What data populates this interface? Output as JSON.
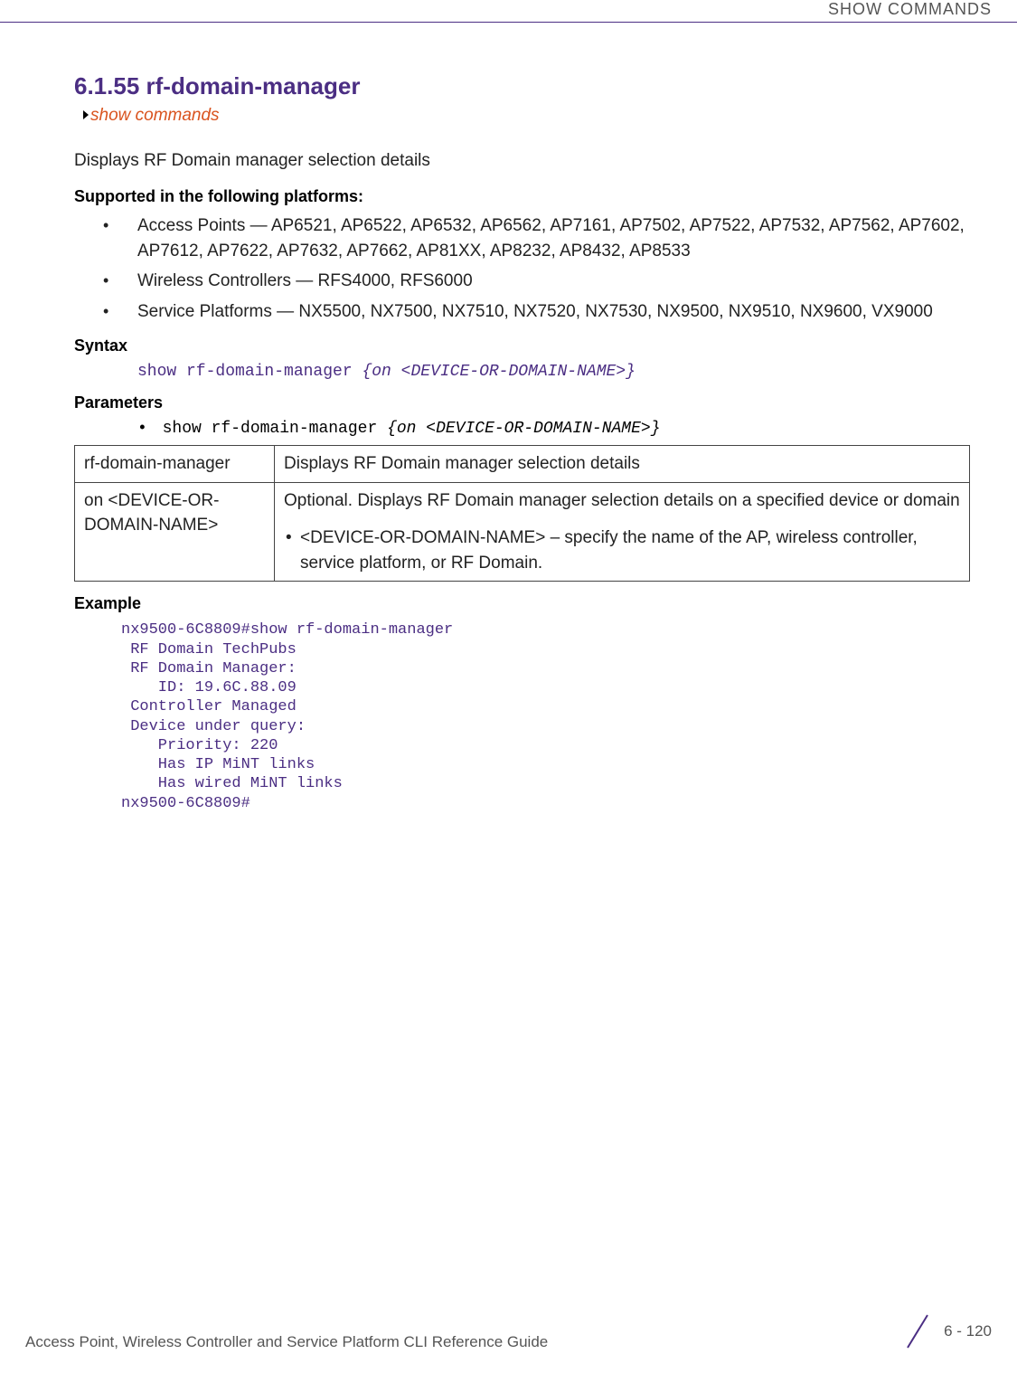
{
  "header": {
    "chapter": "SHOW COMMANDS"
  },
  "section": {
    "number_title": "6.1.55 rf-domain-manager",
    "breadcrumb": "show commands",
    "intro": "Displays RF Domain manager selection details"
  },
  "supported": {
    "heading": "Supported in the following platforms:",
    "items": [
      "Access Points — AP6521, AP6522, AP6532, AP6562, AP7161, AP7502, AP7522, AP7532, AP7562, AP7602, AP7612, AP7622, AP7632, AP7662, AP81XX, AP8232, AP8432, AP8533",
      "Wireless Controllers — RFS4000, RFS6000",
      "Service Platforms — NX5500, NX7500, NX7510, NX7520, NX7530, NX9500, NX9510, NX9600, VX9000"
    ]
  },
  "syntax": {
    "heading": "Syntax",
    "line_plain": "show rf-domain-manager ",
    "line_ital": "{on <DEVICE-OR-DOMAIN-NAME>}"
  },
  "parameters": {
    "heading": "Parameters",
    "usage_bullet": "• ",
    "usage_plain": "show rf-domain-manager ",
    "usage_ital": "{on <DEVICE-OR-DOMAIN-NAME>}",
    "table": [
      {
        "param": "rf-domain-manager",
        "desc": "Displays RF Domain manager selection details"
      },
      {
        "param": "on <DEVICE-OR-DOMAIN-NAME>",
        "desc_main": "Optional. Displays RF Domain manager selection details on a specified device or domain",
        "desc_bullet": "<DEVICE-OR-DOMAIN-NAME> – specify the name of the AP, wireless controller, service platform, or RF Domain."
      }
    ]
  },
  "example": {
    "heading": "Example",
    "block": "nx9500-6C8809#show rf-domain-manager\n RF Domain TechPubs\n RF Domain Manager:\n    ID: 19.6C.88.09\n Controller Managed\n Device under query:\n    Priority: 220\n    Has IP MiNT links\n    Has wired MiNT links\nnx9500-6C8809#"
  },
  "footer": {
    "guide": "Access Point, Wireless Controller and Service Platform CLI Reference Guide",
    "page": "6 - 120"
  }
}
